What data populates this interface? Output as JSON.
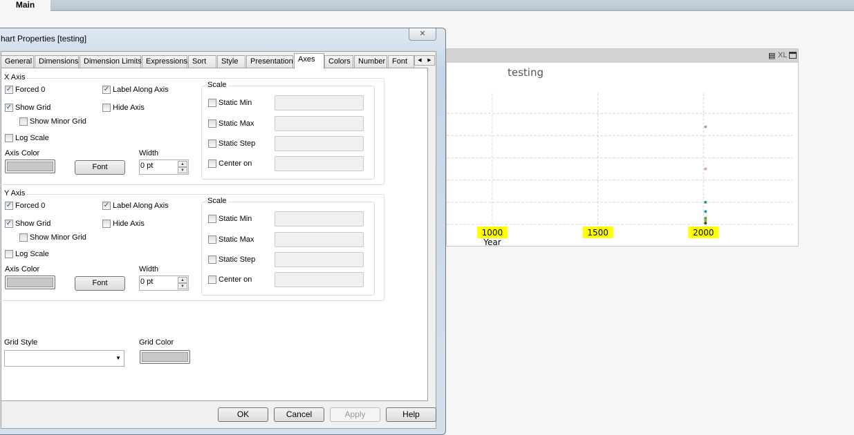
{
  "app": {
    "tab_main": "Main"
  },
  "dialog": {
    "title": "hart Properties [testing]",
    "close_icon": "close-icon",
    "tabs": [
      "General",
      "Dimensions",
      "Dimension Limits",
      "Expressions",
      "Sort",
      "Style",
      "Presentation",
      "Axes",
      "Colors",
      "Number",
      "Font"
    ],
    "active_tab": "Axes",
    "x_axis": {
      "title": "X Axis",
      "forced0": "Forced 0",
      "forced0_checked": true,
      "label_along": "Label Along Axis",
      "label_along_checked": true,
      "show_grid": "Show Grid",
      "show_grid_checked": true,
      "hide_axis": "Hide Axis",
      "hide_axis_checked": false,
      "minor_grid": "Show Minor Grid",
      "log_scale": "Log Scale",
      "axis_color": "Axis Color",
      "font": "Font",
      "width_label": "Width",
      "width_value": "0 pt",
      "scale": {
        "title": "Scale",
        "static_min": "Static Min",
        "static_max": "Static Max",
        "static_step": "Static Step",
        "center_on": "Center on"
      }
    },
    "y_axis": {
      "title": "Y Axis",
      "forced0": "Forced 0",
      "forced0_checked": true,
      "label_along": "Label Along Axis",
      "label_along_checked": true,
      "show_grid": "Show Grid",
      "show_grid_checked": true,
      "hide_axis": "Hide Axis",
      "hide_axis_checked": false,
      "minor_grid": "Show Minor Grid",
      "log_scale": "Log Scale",
      "axis_color": "Axis Color",
      "font": "Font",
      "width_label": "Width",
      "width_value": "0 pt",
      "scale": {
        "title": "Scale",
        "static_min": "Static Min",
        "static_max": "Static Max",
        "static_step": "Static Step",
        "center_on": "Center on"
      }
    },
    "grid_style": "Grid Style",
    "grid_color": "Grid Color",
    "buttons": {
      "ok": "OK",
      "cancel": "Cancel",
      "apply": "Apply",
      "help": "Help"
    }
  },
  "chart_data": {
    "type": "scatter",
    "title": "testing",
    "xlabel": "Year",
    "xticks": [
      "1000",
      "1500",
      "2000"
    ],
    "points": [
      {
        "x": 2010,
        "y": 4.4,
        "color": "#c09a7a"
      },
      {
        "x": 2010,
        "y": 2.5,
        "color": "#d9a0b0"
      },
      {
        "x": 2010,
        "y": 1.0,
        "color": "#1a9a9a"
      },
      {
        "x": 2010,
        "y": 0.58,
        "color": "#1a9a9a"
      },
      {
        "x": 2010,
        "y": 0.28,
        "color": "#4a9a4a"
      },
      {
        "x": 2010,
        "y": 0.17,
        "color": "#9aaa3a"
      },
      {
        "x": 2010,
        "y": 0.06,
        "color": "#5a4020"
      }
    ],
    "xlim": [
      784,
      2448
    ],
    "ylim": [
      0,
      5.6
    ],
    "caption_icons": [
      "print-icon",
      "xl-icon",
      "maximize-icon"
    ],
    "xl": "XL"
  }
}
